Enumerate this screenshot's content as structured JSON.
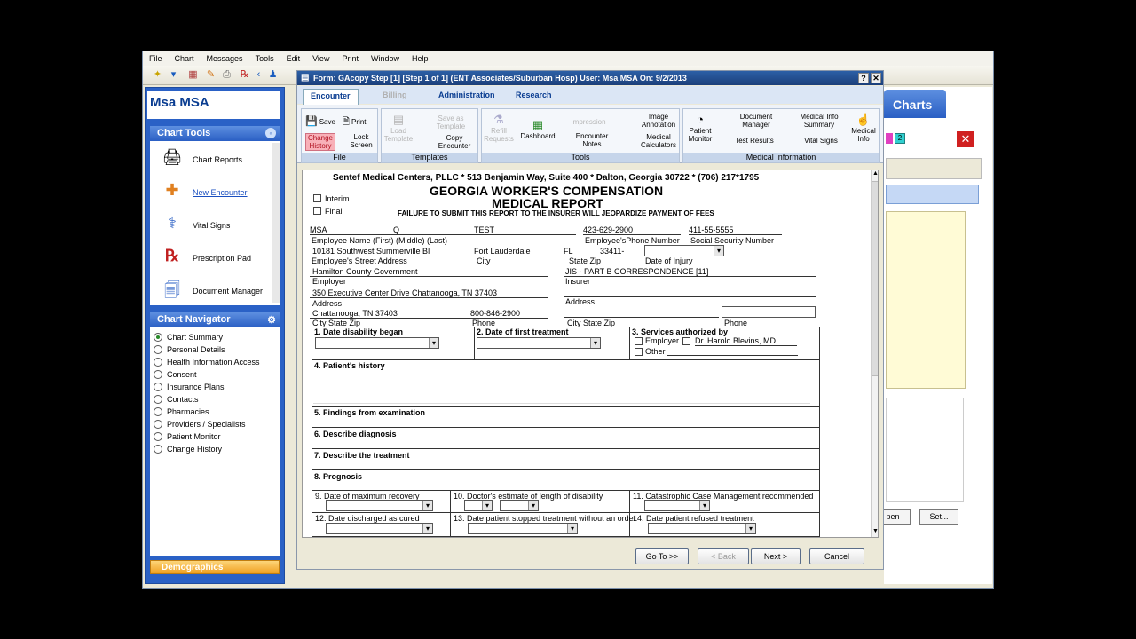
{
  "menu": [
    "File",
    "Chart",
    "Messages",
    "Tools",
    "Edit",
    "View",
    "Print",
    "Window",
    "Help"
  ],
  "patient_name": "Msa MSA",
  "chart_tools": {
    "title": "Chart Tools",
    "items": [
      {
        "label": "Chart Reports",
        "icon": "printer-icon"
      },
      {
        "label": "New Encounter",
        "icon": "new-encounter-icon"
      },
      {
        "label": "Vital Signs",
        "icon": "stethoscope-icon"
      },
      {
        "label": "Prescription Pad",
        "icon": "rx-icon"
      },
      {
        "label": "Document Manager",
        "icon": "document-icon"
      }
    ]
  },
  "chart_navigator": {
    "title": "Chart Navigator",
    "items": [
      "Chart Summary",
      "Personal Details",
      "Health Information Access",
      "Consent",
      "Insurance Plans",
      "Contacts",
      "Pharmacies",
      "Providers / Specialists",
      "Patient Monitor",
      "Change History"
    ]
  },
  "demographics": "Demographics",
  "right_tab": "Charts",
  "right_buttons": {
    "open": "pen",
    "set": "Set..."
  },
  "dialog": {
    "title": "Form: GAcopy Step [1]   [Step 1 of 1]  (ENT Associates/Suburban Hosp)  User: Msa MSA   On: 9/2/2013",
    "help": "?",
    "close": "✕",
    "tabs": [
      "Encounter",
      "Billing",
      "Administration",
      "Research"
    ],
    "ribbon": {
      "file": {
        "title": "File",
        "save": "Save",
        "print": "Print",
        "change_history": "Change History",
        "lock_screen": "Lock Screen"
      },
      "templates": {
        "title": "Templates",
        "load_template": "Load Template",
        "save_as_template": "Save as Template",
        "copy_encounter": "Copy Encounter"
      },
      "tools": {
        "title": "Tools",
        "refill_requests": "Refill Requests",
        "dashboard": "Dashboard",
        "impression": "Impression",
        "encounter_notes": "Encounter Notes",
        "image_annotation": "Image Annotation",
        "medical_calculators": "Medical Calculators"
      },
      "medical_info": {
        "title": "Medical Information",
        "patient_monitor": "Patient Monitor",
        "document_manager": "Document Manager",
        "test_results": "Test Results",
        "medical_info_summary": "Medical Info Summary",
        "vital_signs": "Vital Signs",
        "medical_info": "Medical Info"
      }
    },
    "buttons": {
      "goto": "Go To >>",
      "back": "< Back",
      "next": "Next >",
      "cancel": "Cancel"
    }
  },
  "form": {
    "header": "Sentef Medical Centers, PLLC * 513 Benjamin Way, Suite 400 * Dalton, Georgia 30722 * (706) 217*1795",
    "title1": "GEORGIA WORKER'S COMPENSATION",
    "title2": "MEDICAL REPORT",
    "interim": "Interim",
    "final": "Final",
    "warning": "FAILURE TO SUBMIT THIS REPORT TO THE INSURER WILL JEOPARDIZE PAYMENT OF FEES",
    "emp_first": "MSA",
    "emp_middle": "Q",
    "emp_last": "TEST",
    "emp_phone": "423-629-2900",
    "ssn": "411-55-5555",
    "lbl_name": "Employee Name   (First)     (Middle)       (Last)",
    "lbl_phone": "Employee'sPhone Number",
    "lbl_ssn": "Social Security Number",
    "street": "10181 Southwest Summerville Bl",
    "city": "Fort Lauderdale",
    "state": "FL",
    "zip": "33411-",
    "lbl_street": "Employee's Street Address",
    "lbl_city": "City",
    "lbl_state_zip": "State      Zip",
    "lbl_doi": "Date of Injury",
    "employer": "Hamilton County Government",
    "insurer": "JIS - PART B CORRESPONDENCE [11]",
    "lbl_employer": "Employer",
    "lbl_insurer": "Insurer",
    "address": "350 Executive Center Drive Chattanooga, TN 37403",
    "lbl_address": "Address",
    "lbl_address2": "Address",
    "city2": "Chattanooga, TN 37403",
    "phone2": "800-846-2900",
    "lbl_city_row": "City           State          Zip",
    "lbl_phone2": "Phone",
    "lbl_city_row2": "City           State          Zip",
    "lbl_phone3": "Phone",
    "s1": "1. Date disability began",
    "s2": "2. Date of first treatment",
    "s3": "3. Services authorized by",
    "s3_employer": "Employer",
    "s3_dr": "Dr. Harold Blevins, MD",
    "s3_other": "Other",
    "s4": "4. Patient's history",
    "s5": "5. Findings from examination",
    "s6": "6. Describe diagnosis",
    "s7": "7. Describe the treatment",
    "s8": "8. Prognosis",
    "s9": "9. Date of maximum recovery",
    "s10": "10. Doctor's estimate of length of disability",
    "s11": "11. Catastrophic Case Management recommended",
    "s12": "12. Date discharged as cured",
    "s13": "13. Date patient stopped treatment without an order",
    "s14": "14. Date patient refused treatment"
  },
  "colors": {
    "accent": "#2a61c6",
    "title_bar": "#1c3f7a",
    "highlight": "#f0a020"
  }
}
